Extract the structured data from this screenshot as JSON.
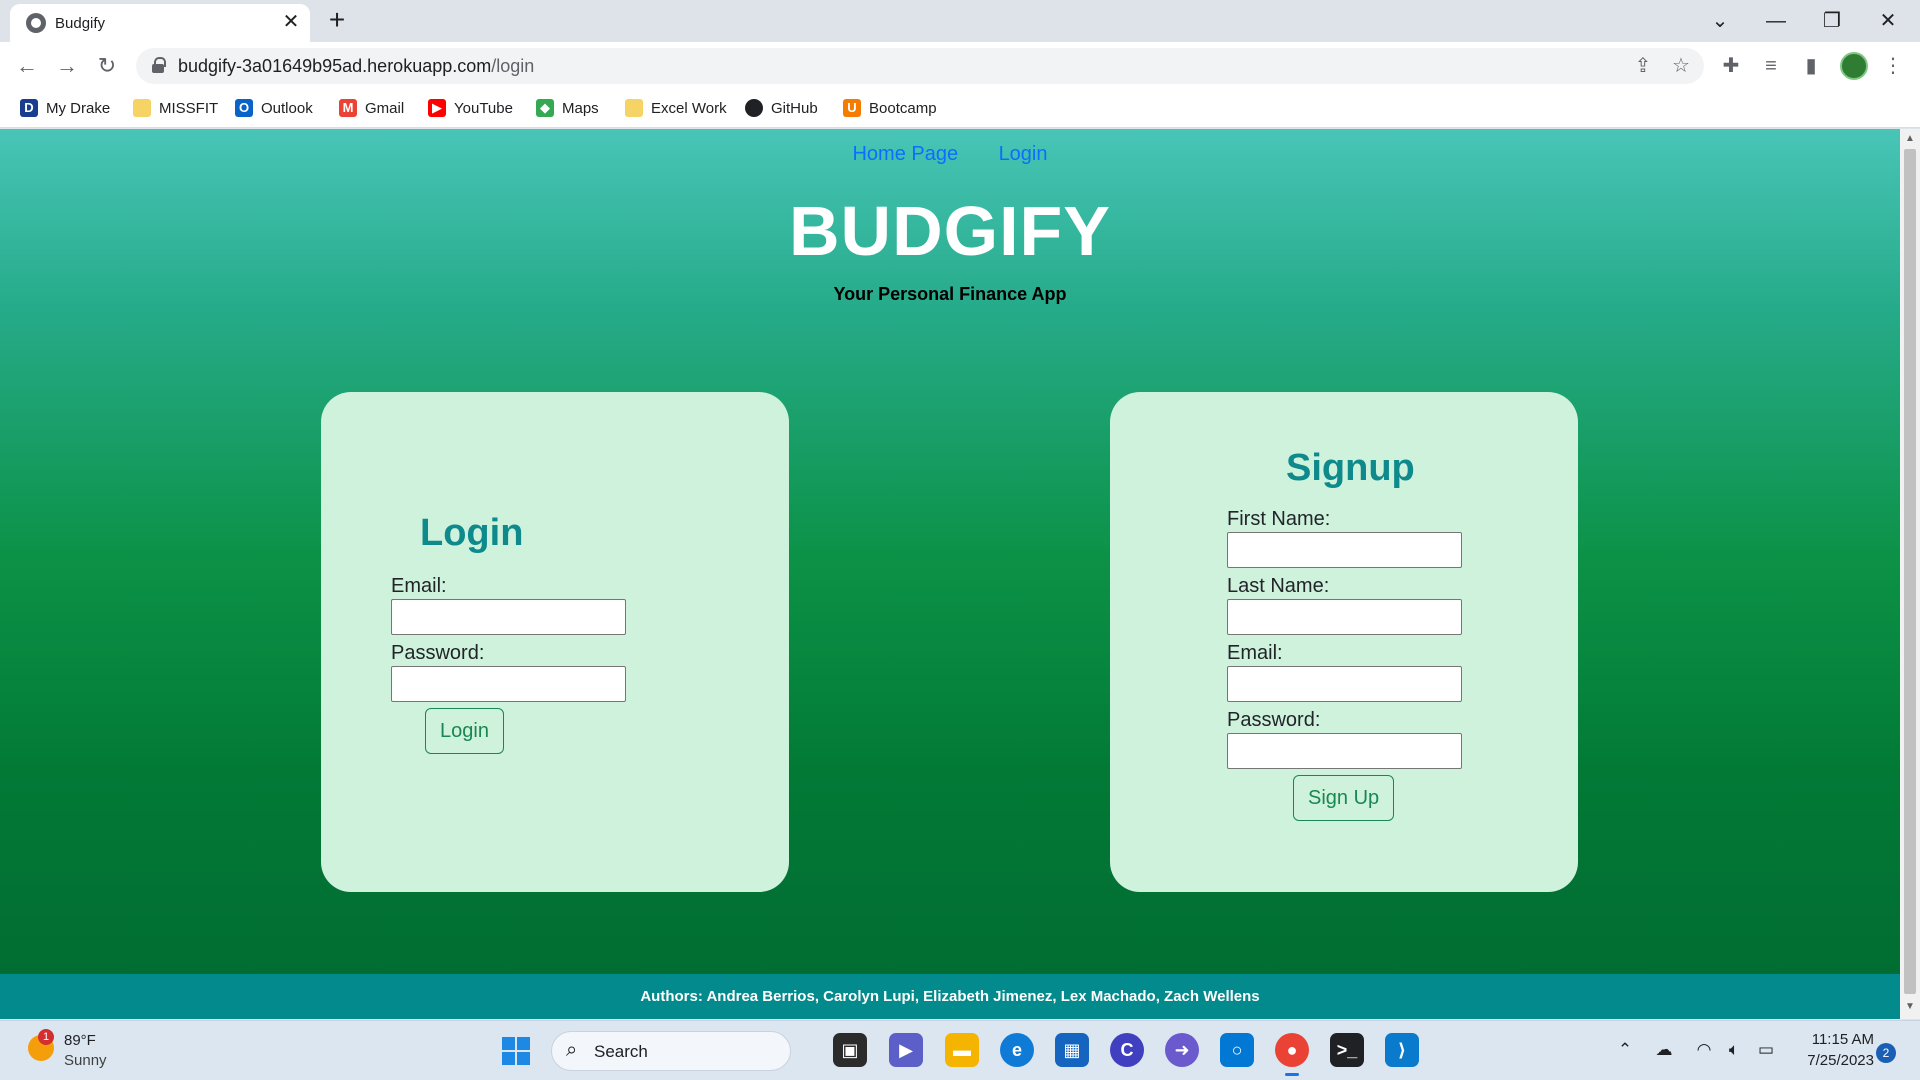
{
  "browser": {
    "tab_title": "Budgify",
    "tab_close": "✕",
    "new_tab": "+",
    "url_domain": "budgify-3a01649b95ad.herokuapp.com",
    "url_path": "/login",
    "window_controls": {
      "tab_search": "⌄",
      "minimize": "—",
      "restore": "❐",
      "close": "✕"
    },
    "nav": {
      "back": "←",
      "forward": "→",
      "reload": "↻"
    },
    "bookmarks": [
      {
        "label": "My Drake",
        "icon": "D",
        "color": "#1a3d8f"
      },
      {
        "label": "MISSFIT",
        "icon": "",
        "color": "#f6d365"
      },
      {
        "label": "Outlook",
        "icon": "O",
        "color": "#0a64c8"
      },
      {
        "label": "Gmail",
        "icon": "M",
        "color": "#ea4335"
      },
      {
        "label": "YouTube",
        "icon": "▶",
        "color": "#ff0000"
      },
      {
        "label": "Maps",
        "icon": "◆",
        "color": "#34a853"
      },
      {
        "label": "Excel Work",
        "icon": "",
        "color": "#f6d365"
      },
      {
        "label": "GitHub",
        "icon": "●",
        "color": "#202124"
      },
      {
        "label": "Bootcamp",
        "icon": "U",
        "color": "#f57c00"
      }
    ]
  },
  "site": {
    "nav": {
      "home": "Home Page",
      "login": "Login"
    },
    "brand": "BUDGIFY",
    "tagline": "Your Personal Finance App",
    "login_form": {
      "title": "Login",
      "email_label": "Email:",
      "email_value": "",
      "password_label": "Password:",
      "password_value": "",
      "submit": "Login"
    },
    "signup_form": {
      "title": "Signup",
      "first_name_label": "First Name:",
      "first_name_value": "",
      "last_name_label": "Last Name:",
      "last_name_value": "",
      "email_label": "Email:",
      "email_value": "",
      "password_label": "Password:",
      "password_value": "",
      "submit": "Sign Up"
    },
    "footer": "Authors: Andrea Berrios, Carolyn Lupi, Elizabeth Jimenez, Lex Machado, Zach Wellens"
  },
  "taskbar": {
    "weather_temp": "89°F",
    "weather_desc": "Sunny",
    "weather_badge": "1",
    "search_label": "Search",
    "time": "11:15 AM",
    "date": "7/25/2023",
    "notification_count": "2"
  },
  "colors": {
    "brand_teal": "#0e8a8d",
    "card_bg": "#cff2dc",
    "button_green": "#198754",
    "footer_bg": "#038a8c",
    "link_blue": "#0d6efd"
  }
}
